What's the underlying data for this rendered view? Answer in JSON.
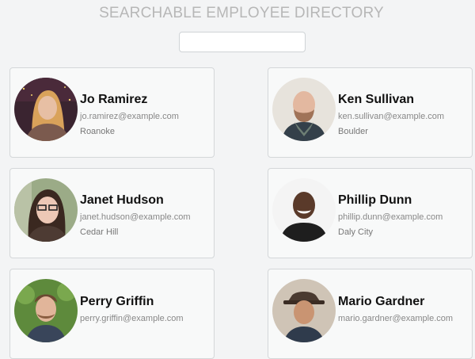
{
  "header": {
    "title": "SEARCHABLE EMPLOYEE DIRECTORY"
  },
  "search": {
    "value": "",
    "placeholder": ""
  },
  "employees": [
    {
      "name": "Jo Ramirez",
      "email": "jo.ramirez@example.com",
      "city": "Roanoke"
    },
    {
      "name": "Ken Sullivan",
      "email": "ken.sullivan@example.com",
      "city": "Boulder"
    },
    {
      "name": "Janet Hudson",
      "email": "janet.hudson@example.com",
      "city": "Cedar Hill"
    },
    {
      "name": "Phillip Dunn",
      "email": "phillip.dunn@example.com",
      "city": "Daly City"
    },
    {
      "name": "Perry Griffin",
      "email": "perry.griffin@example.com",
      "city": ""
    },
    {
      "name": "Mario Gardner",
      "email": "mario.gardner@example.com",
      "city": ""
    }
  ],
  "colors": {
    "title": "#b7b7b7",
    "card_bg": "#f8f9f9",
    "card_border": "#d4d7d9",
    "page_bg": "#f3f4f5"
  }
}
